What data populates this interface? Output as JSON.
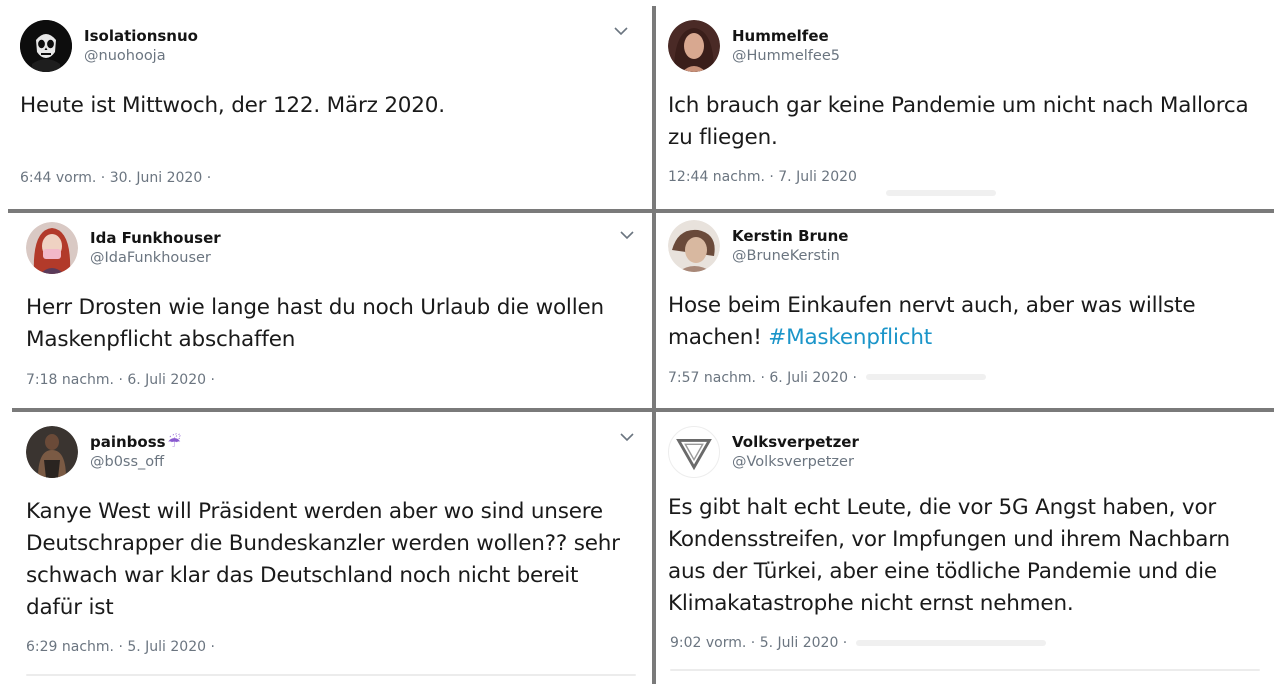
{
  "tweets": [
    {
      "name": "Isolationsnuo",
      "handle": "@nuohooja",
      "text": "Heute ist Mittwoch, der 122. März 2020.",
      "meta": "6:44 vorm. · 30. Juni 2020 ·",
      "avatar_icon": "skull-icon"
    },
    {
      "name": "Hummelfee",
      "handle": "@Hummelfee5",
      "text": "Ich brauch gar keine Pandemie um nicht nach Mallorca zu fliegen.",
      "meta": "12:44 nachm. · 7. Juli 2020",
      "avatar_icon": "photo-avatar"
    },
    {
      "name": "Ida Funkhouser",
      "handle": "@IdaFunkhouser",
      "text": "Herr Drosten wie lange hast du noch Urlaub die wollen Maskenpflicht abschaffen",
      "meta": "7:18 nachm. · 6. Juli 2020 ·",
      "avatar_icon": "photo-avatar"
    },
    {
      "name": "Kerstin Brune",
      "handle": "@BruneKerstin",
      "text": "Hose beim Einkaufen nervt auch, aber was willste machen!",
      "hashtag": "#Maskenpflicht",
      "meta": "7:57 nachm. · 6. Juli 2020 ·",
      "avatar_icon": "photo-avatar"
    },
    {
      "name": "painboss",
      "name_emoji": "☔",
      "handle": "@b0ss_off",
      "text": "Kanye West will Präsident werden aber wo sind unsere Deutschrapper die Bundeskanzler werden wollen?? sehr schwach war klar das Deutschland noch nicht bereit dafür ist",
      "meta": "6:29 nachm. · 5. Juli 2020 ·",
      "avatar_icon": "photo-avatar"
    },
    {
      "name": "Volksverpetzer",
      "handle": "@Volksverpetzer",
      "text": "Es gibt halt echt Leute, die vor 5G Angst haben, vor Kondensstreifen, vor Impfungen und ihrem Nachbarn aus der Türkei, aber eine tödliche Pandemie und die Klimakatastrophe nicht ernst nehmen.",
      "meta": "9:02 vorm. · 5. Juli 2020 ·",
      "avatar_icon": "triangle-logo-icon"
    }
  ],
  "colors": {
    "hashtag": "#1b95c9",
    "meta": "#6b7580",
    "divider": "#7a7a7a"
  }
}
